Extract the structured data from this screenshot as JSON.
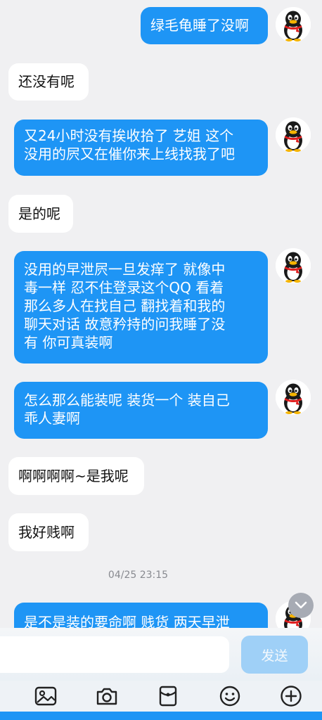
{
  "messages": [
    {
      "side": "out",
      "text": "绿毛龟睡了没啊"
    },
    {
      "side": "in",
      "text": "还没有呢"
    },
    {
      "side": "out",
      "text": "又24小时没有挨收拾了 艺姐 这个\n没用的屄又在催你来上线找我了吧"
    },
    {
      "side": "in",
      "text": "是的呢"
    },
    {
      "side": "out",
      "text": "没用的早泄屄一旦发痒了 就像中\n毒一样 忍不住登录这个QQ 看着\n那么多人在找自己 翻找着和我的\n聊天对话 故意矜持的问我睡了没\n有 你可真装啊"
    },
    {
      "side": "out",
      "text": "怎么那么能装呢 装货一个 装自己\n乖人妻啊"
    },
    {
      "side": "in",
      "text": "啊啊啊啊~是我呢"
    },
    {
      "side": "in",
      "text": "我好贱啊"
    },
    {
      "side": "out",
      "text": "是不是装的要命啊 贱货 两天早泄"
    }
  ],
  "timestamp": "04/25 23:15",
  "composer": {
    "placeholder": "",
    "send_label": "发送"
  },
  "toolbar": [
    "image-icon",
    "camera-icon",
    "red-packet-icon",
    "emoji-icon",
    "plus-icon"
  ],
  "colors": {
    "outgoing": "#1e95f5",
    "incoming": "#ffffff",
    "background": "#f0f0f2",
    "send": "#9fd0f7"
  }
}
